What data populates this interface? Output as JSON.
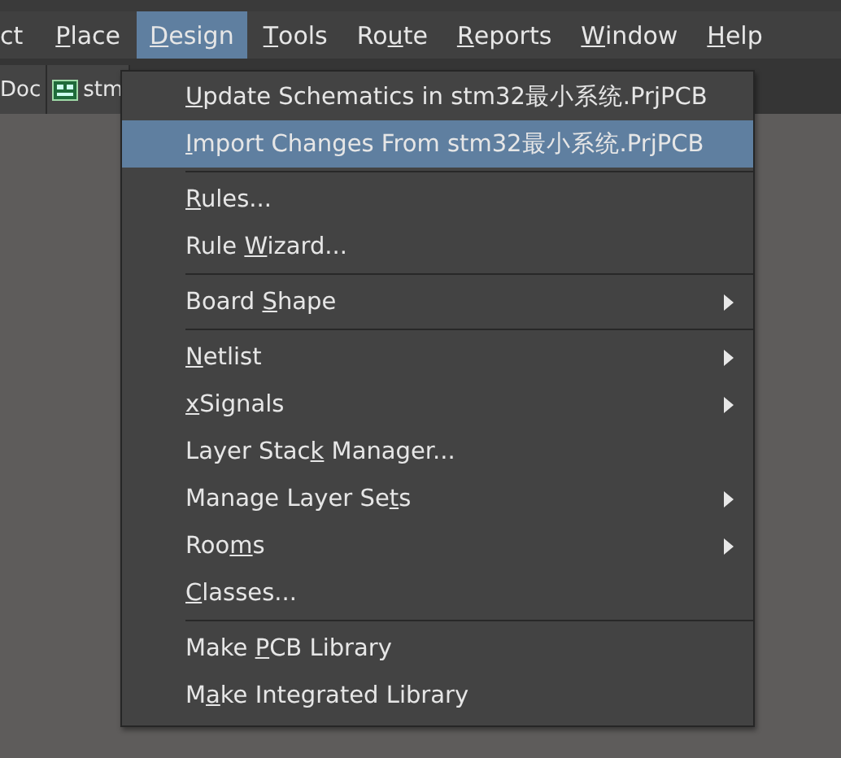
{
  "menubar": [
    {
      "post": "ct",
      "selected": false
    },
    {
      "key": "P",
      "post": "lace",
      "selected": false
    },
    {
      "key": "D",
      "post": "esign",
      "selected": true
    },
    {
      "key": "T",
      "post": "ools",
      "selected": false
    },
    {
      "pre": "Ro",
      "key": "u",
      "post": "te",
      "selected": false
    },
    {
      "key": "R",
      "post": "eports",
      "selected": false
    },
    {
      "key": "W",
      "post": "indow",
      "selected": false
    },
    {
      "key": "H",
      "post": "elp",
      "selected": false
    }
  ],
  "tabs": [
    {
      "label": "Doc",
      "kind": "plain"
    },
    {
      "label": "stm",
      "kind": "pcb"
    }
  ],
  "menu": {
    "groups": [
      [
        {
          "key": "U",
          "post": "pdate Schematics in stm32最小系统.PrjPCB",
          "submenu": false,
          "selected": false
        },
        {
          "key": "I",
          "post": "mport Changes From stm32最小系统.PrjPCB",
          "submenu": false,
          "selected": true
        }
      ],
      [
        {
          "key": "R",
          "post": "ules...",
          "submenu": false,
          "selected": false
        },
        {
          "pre": "Rule ",
          "key": "W",
          "post": "izard...",
          "submenu": false,
          "selected": false
        }
      ],
      [
        {
          "pre": "Board ",
          "key": "S",
          "post": "hape",
          "submenu": true,
          "selected": false
        }
      ],
      [
        {
          "key": "N",
          "post": "etlist",
          "submenu": true,
          "selected": false
        },
        {
          "key": "x",
          "post": "Signals",
          "submenu": true,
          "selected": false
        },
        {
          "pre": "Layer Stac",
          "key": "k",
          "post": " Manager...",
          "submenu": false,
          "selected": false
        },
        {
          "pre": "Manage Layer Se",
          "key": "t",
          "post": "s",
          "submenu": true,
          "selected": false
        },
        {
          "pre": "Roo",
          "key": "m",
          "post": "s",
          "submenu": true,
          "selected": false
        },
        {
          "key": "C",
          "post": "lasses...",
          "submenu": false,
          "selected": false
        }
      ],
      [
        {
          "pre": "Make ",
          "key": "P",
          "post": "CB Library",
          "submenu": false,
          "selected": false
        },
        {
          "pre": "M",
          "key": "a",
          "post": "ke Integrated Library",
          "submenu": false,
          "selected": false
        }
      ]
    ]
  }
}
